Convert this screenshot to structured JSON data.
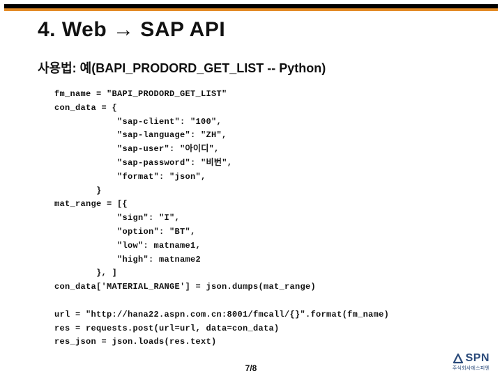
{
  "title": "4. Web → SAP API",
  "subtitle": "사용법: 예(BAPI_PRODORD_GET_LIST -- Python)",
  "code": "fm_name = \"BAPI_PRODORD_GET_LIST\"\ncon_data = {\n            \"sap-client\": \"100\",\n            \"sap-language\": \"ZH\",\n            \"sap-user\": \"아이디\",\n            \"sap-password\": \"비번\",\n            \"format\": \"json\",\n        }\nmat_range = [{\n            \"sign\": \"I\",\n            \"option\": \"BT\",\n            \"low\": matname1,\n            \"high\": matname2\n        }, ]\ncon_data['MATERIAL_RANGE'] = json.dumps(mat_range)\n\nurl = \"http://hana22.aspn.com.cn:8001/fmcall/{}\".format(fm_name)\nres = requests.post(url=url, data=con_data)\nres_json = json.loads(res.text)",
  "page_number": "7/8",
  "logo": {
    "text": "SPN",
    "sub": "주식회사에스피엔"
  }
}
